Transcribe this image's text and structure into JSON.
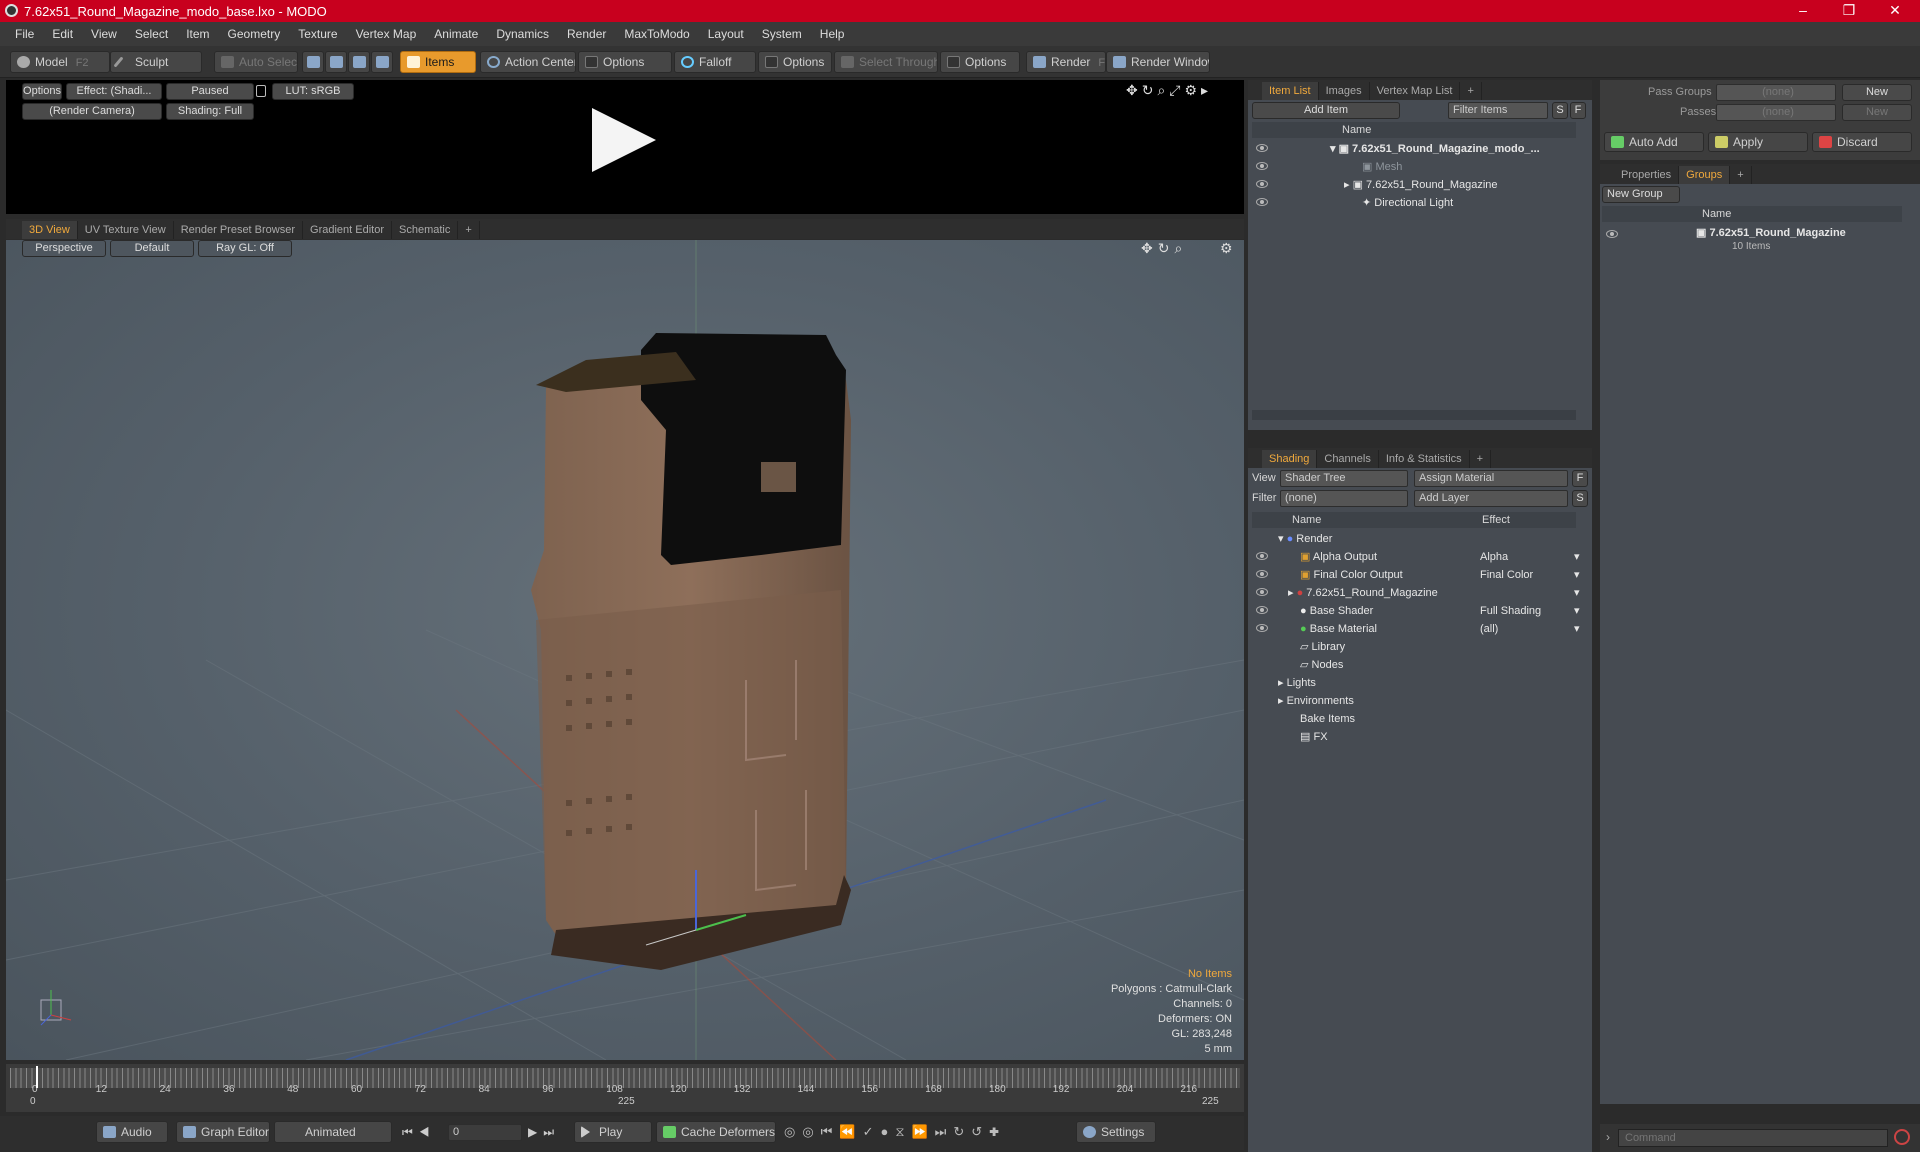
{
  "window": {
    "title": "7.62x51_Round_Magazine_modo_base.lxo - MODO",
    "minimize": "–",
    "maximize": "❐",
    "close": "✕"
  },
  "menu": [
    "File",
    "Edit",
    "View",
    "Select",
    "Item",
    "Geometry",
    "Texture",
    "Vertex Map",
    "Animate",
    "Dynamics",
    "Render",
    "MaxToModo",
    "Layout",
    "System",
    "Help"
  ],
  "toolbar": {
    "model": "Model",
    "model_key": "F2",
    "sculpt": "Sculpt",
    "auto_select": "Auto Select",
    "items": "Items",
    "action_center": "Action Center",
    "options1": "Options",
    "falloff": "Falloff",
    "options2": "Options",
    "select_through": "Select Through",
    "options3": "Options",
    "render": "Render",
    "render_key": "F9",
    "render_window": "Render Window"
  },
  "preview": {
    "options": "Options",
    "effect": "Effect: (Shadi...",
    "paused": "Paused",
    "lut": "LUT: sRGB",
    "camera": "(Render Camera)",
    "shading": "Shading: Full"
  },
  "viewport_tabs": [
    "3D View",
    "UV Texture View",
    "Render Preset Browser",
    "Gradient Editor",
    "Schematic"
  ],
  "viewport": {
    "perspective": "Perspective",
    "default": "Default",
    "raygl": "Ray GL: Off"
  },
  "hud": {
    "items": "No Items",
    "polygons": "Polygons : Catmull-Clark",
    "channels": "Channels: 0",
    "deformers": "Deformers: ON",
    "gl": "GL: 283,248",
    "scale": "5 mm"
  },
  "timeline": {
    "ticks": [
      "0",
      "12",
      "24",
      "36",
      "48",
      "60",
      "72",
      "84",
      "96",
      "108",
      "120",
      "132",
      "144",
      "156",
      "168",
      "180",
      "192",
      "204",
      "216"
    ],
    "start": "0",
    "mid": "225",
    "end": "225"
  },
  "bottombar": {
    "audio": "Audio",
    "graph_editor": "Graph Editor",
    "animated": "Animated",
    "frame": "0",
    "play": "Play",
    "cache": "Cache Deformers",
    "settings": "Settings"
  },
  "itemlist": {
    "tabs": [
      "Item List",
      "Images",
      "Vertex Map List"
    ],
    "add_item": "Add Item",
    "filter": "Filter Items",
    "s": "S",
    "f": "F",
    "col_name": "Name",
    "rows": [
      "7.62x51_Round_Magazine_modo_...",
      "Mesh",
      "7.62x51_Round_Magazine",
      "Directional Light"
    ]
  },
  "shading": {
    "tabs": [
      "Shading",
      "Channels",
      "Info & Statistics"
    ],
    "view_label": "View",
    "view_value": "Shader Tree",
    "assign": "Assign Material",
    "f": "F",
    "filter_label": "Filter",
    "filter_value": "(none)",
    "add_layer": "Add Layer",
    "s": "S",
    "col_name": "Name",
    "col_effect": "Effect",
    "rows": [
      {
        "name": "Render",
        "effect": ""
      },
      {
        "name": "Alpha Output",
        "effect": "Alpha"
      },
      {
        "name": "Final Color Output",
        "effect": "Final Color"
      },
      {
        "name": "7.62x51_Round_Magazine",
        "effect": ""
      },
      {
        "name": "Base Shader",
        "effect": "Full Shading"
      },
      {
        "name": "Base Material",
        "effect": "(all)"
      },
      {
        "name": "Library",
        "effect": ""
      },
      {
        "name": "Nodes",
        "effect": ""
      },
      {
        "name": "Lights",
        "effect": ""
      },
      {
        "name": "Environments",
        "effect": ""
      },
      {
        "name": "Bake Items",
        "effect": ""
      },
      {
        "name": "FX",
        "effect": ""
      }
    ]
  },
  "passes": {
    "pass_groups": "Pass Groups",
    "passes": "Passes",
    "none1": "(none)",
    "none2": "(none)",
    "new1": "New",
    "new2": "New",
    "auto_add": "Auto Add",
    "apply": "Apply",
    "discard": "Discard"
  },
  "groups": {
    "tabs": [
      "Properties",
      "Groups"
    ],
    "new_group": "New Group",
    "col_name": "Name",
    "item": "7.62x51_Round_Magazine",
    "count": "10 Items"
  },
  "command": {
    "placeholder": "Command"
  },
  "colors": {
    "accent": "#f0a93c",
    "titlebar": "#c8001e",
    "viewport": "#566068",
    "magazine": "#8a6a55"
  }
}
